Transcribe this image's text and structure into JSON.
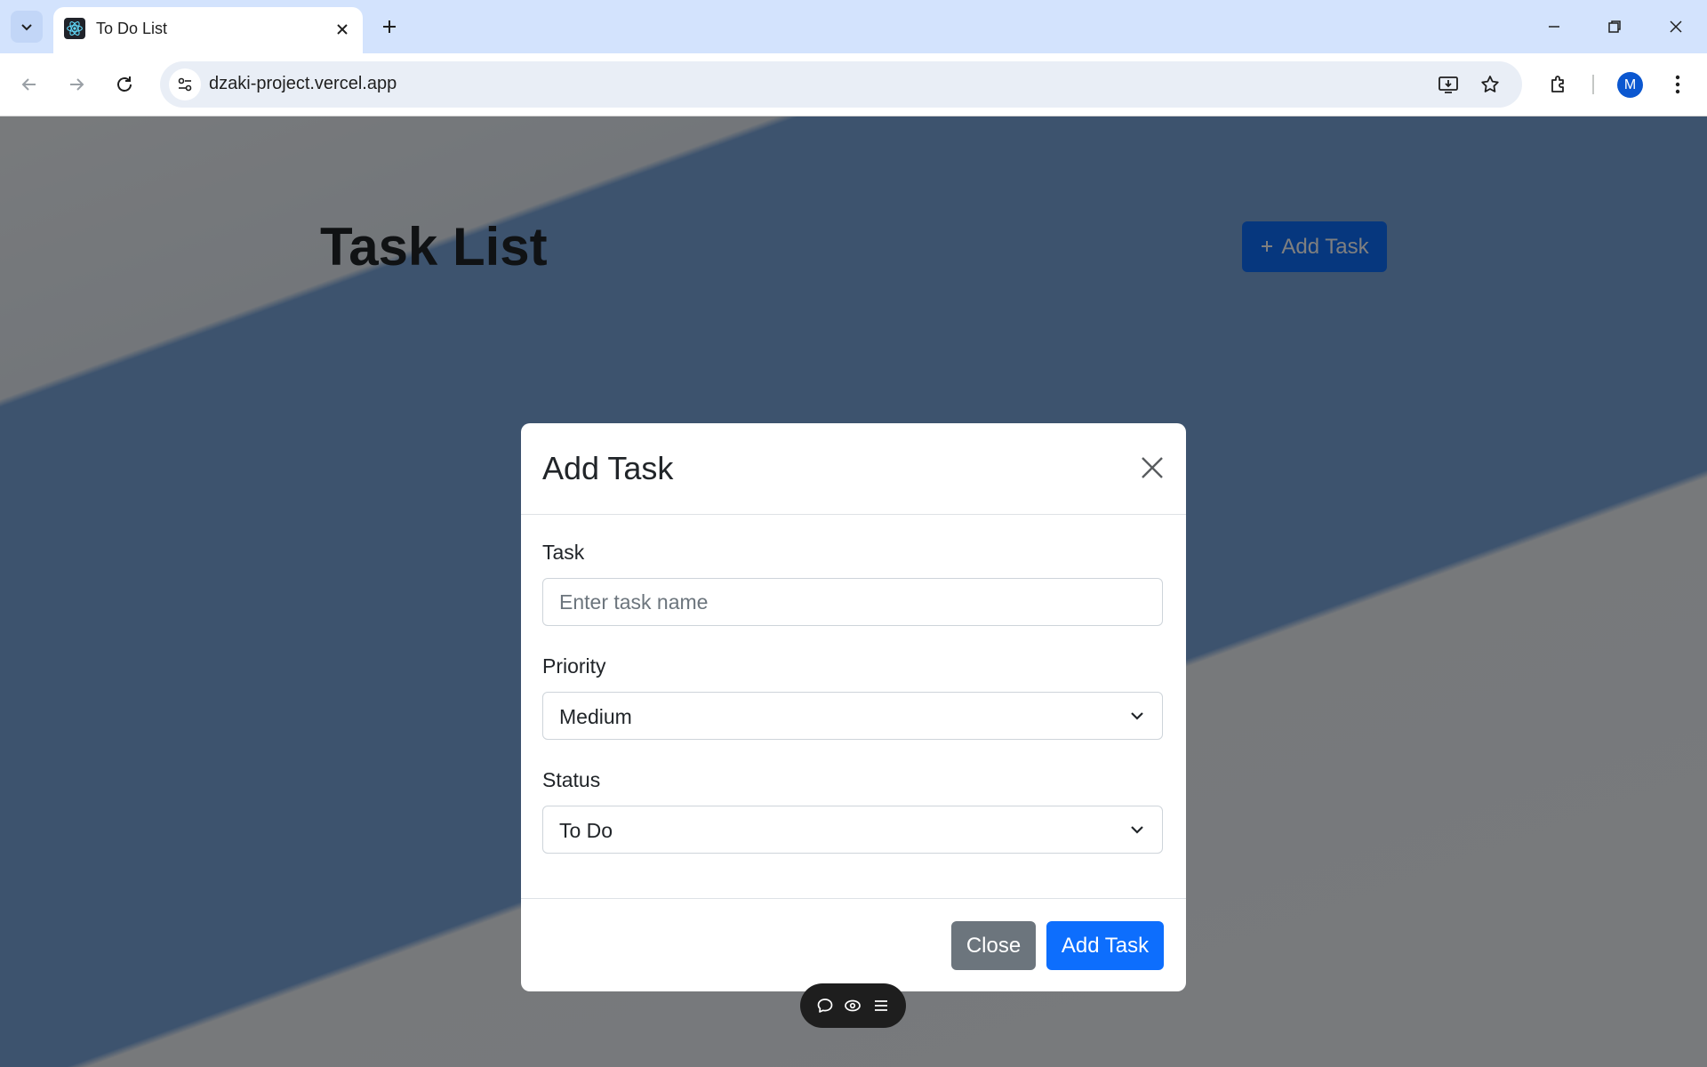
{
  "browser": {
    "tab_title": "To Do List",
    "url": "dzaki-project.vercel.app",
    "profile_initial": "M"
  },
  "page": {
    "title": "Task List",
    "add_button_label": "Add Task",
    "add_button_icon": "plus-icon"
  },
  "modal": {
    "title": "Add Task",
    "task": {
      "label": "Task",
      "placeholder": "Enter task name",
      "value": ""
    },
    "priority": {
      "label": "Priority",
      "selected": "Medium"
    },
    "status": {
      "label": "Status",
      "selected": "To Do"
    },
    "close_label": "Close",
    "submit_label": "Add Task"
  },
  "floating_toolbar": {
    "icons": [
      "comment-icon",
      "eye-icon",
      "menu-icon"
    ]
  },
  "colors": {
    "primary": "#0d6efd",
    "secondary": "#6c757d",
    "tabstrip": "#d3e3fd",
    "omnibox": "#e9eef6"
  }
}
